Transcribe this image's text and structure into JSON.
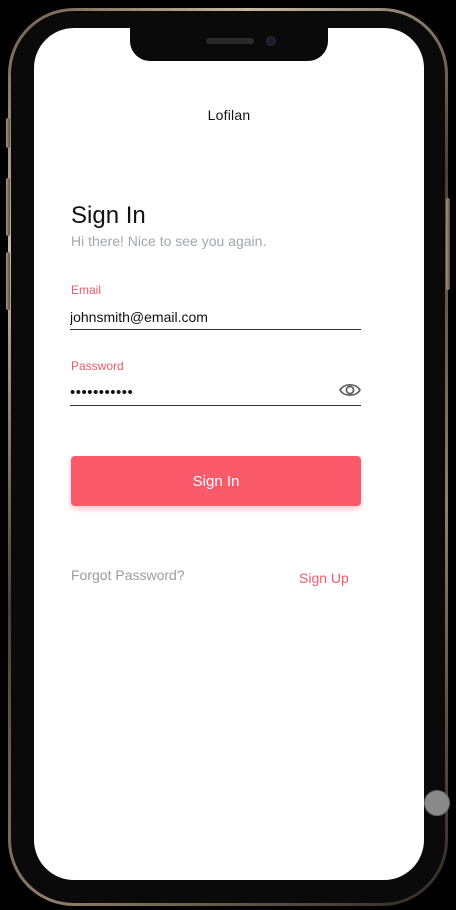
{
  "app": {
    "title": "Lofilan"
  },
  "signin": {
    "heading": "Sign In",
    "subheading": "Hi there! Nice to see you again.",
    "email": {
      "label": "Email",
      "value": "johnsmith@email.com"
    },
    "password": {
      "label": "Password",
      "value": "•••••••••••",
      "toggle_icon": "eye-icon"
    },
    "submit_label": "Sign In",
    "forgot_label": "Forgot Password?",
    "signup_label": "Sign Up"
  },
  "colors": {
    "accent": "#fa5a69",
    "muted_text": "#a3a6b0",
    "label": "#f05a68"
  }
}
